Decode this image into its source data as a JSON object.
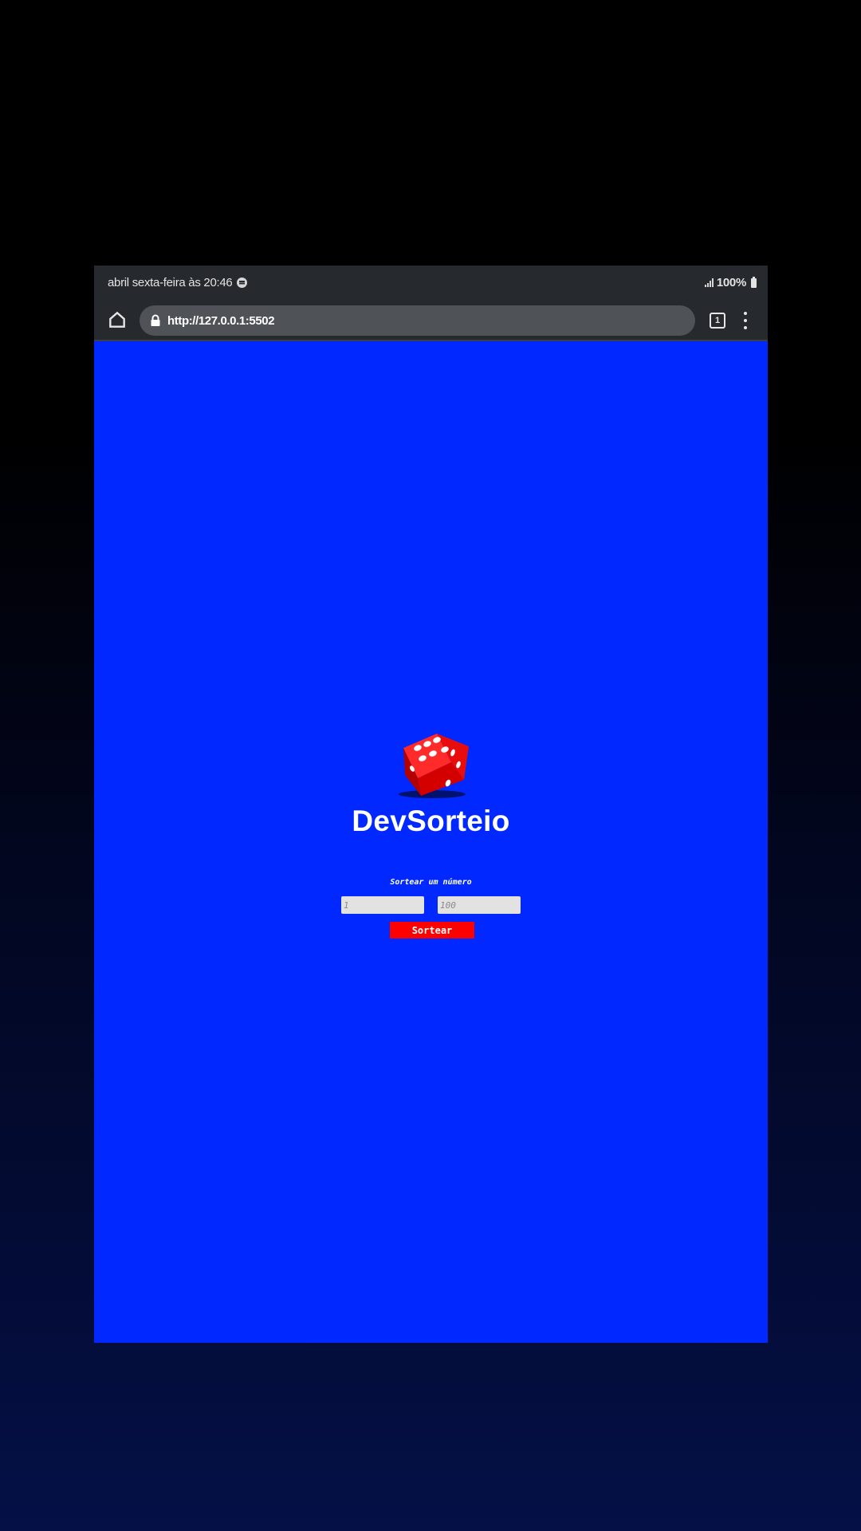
{
  "status_bar": {
    "time_text": "abril sexta-feira às 20:46",
    "battery_text": "100%",
    "notification_icon": "spotify-icon",
    "signal_icon": "signal-icon",
    "battery_icon": "battery-icon"
  },
  "browser": {
    "url": "http://127.0.0.1:5502",
    "tab_count": "1",
    "home_icon": "home-icon",
    "lock_icon": "lock-icon",
    "menu_icon": "menu-icon"
  },
  "app": {
    "logo_icon": "dice-icon",
    "title": "DevSorteio",
    "draw_label": "Sortear um número",
    "min_placeholder": "1",
    "max_placeholder": "100",
    "draw_button_label": "Sortear"
  },
  "colors": {
    "page_background": "#0028ff",
    "button": "#ff0000",
    "browser_chrome": "#26292d",
    "url_field": "#4f5257"
  }
}
